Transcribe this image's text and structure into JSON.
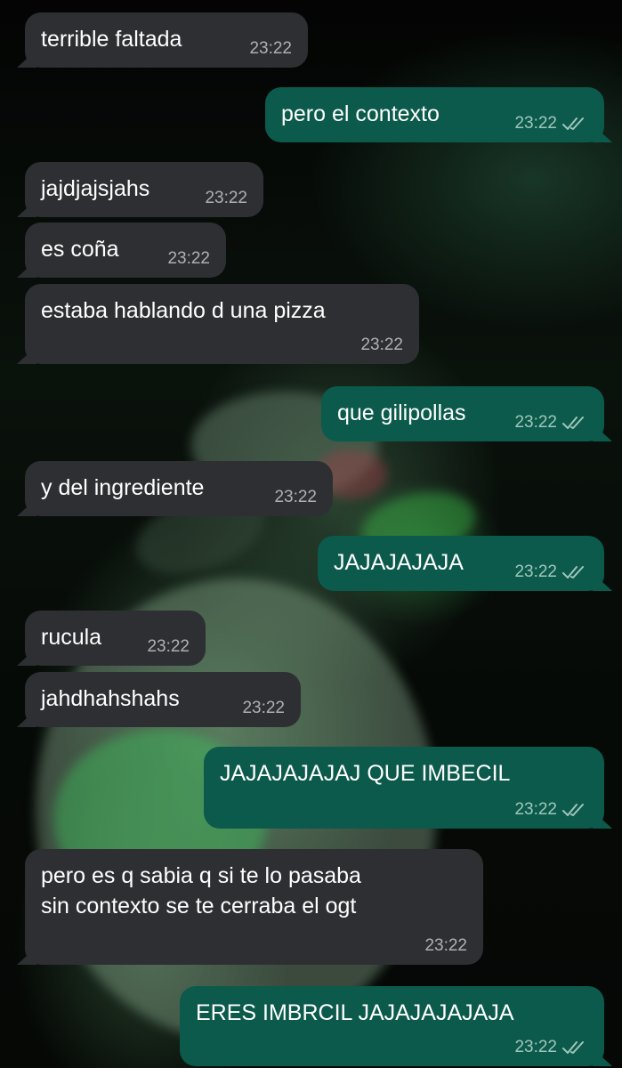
{
  "chat": {
    "messages": [
      {
        "direction": "incoming",
        "text": "terrible faltada",
        "time": "23:22"
      },
      {
        "direction": "outgoing",
        "text": "pero el contexto",
        "time": "23:22",
        "status": "read"
      },
      {
        "direction": "incoming",
        "text": "jajdjajsjahs",
        "time": "23:22"
      },
      {
        "direction": "incoming",
        "text": "es coña",
        "time": "23:22"
      },
      {
        "direction": "incoming",
        "text": "estaba hablando d una pizza",
        "time": "23:22"
      },
      {
        "direction": "outgoing",
        "text": "que gilipollas",
        "time": "23:22",
        "status": "read"
      },
      {
        "direction": "incoming",
        "text": "y del ingrediente",
        "time": "23:22"
      },
      {
        "direction": "outgoing",
        "text": "JAJAJAJAJA",
        "time": "23:22",
        "status": "read"
      },
      {
        "direction": "incoming",
        "text": "rucula",
        "time": "23:22"
      },
      {
        "direction": "incoming",
        "text": "jahdhahshahs",
        "time": "23:22"
      },
      {
        "direction": "outgoing",
        "text": "JAJAJAJAJAJ QUE IMBECIL",
        "time": "23:22",
        "status": "read"
      },
      {
        "direction": "incoming",
        "text": "pero es q sabia q si te lo pasaba\nsin contexto se te cerraba el ogt",
        "time": "23:22"
      },
      {
        "direction": "outgoing",
        "text": "ERES IMBRCIL JAJAJAJAJAJA",
        "time": "23:22",
        "status": "read"
      }
    ]
  },
  "colors": {
    "incoming_bubble": "#2e2f33",
    "outgoing_bubble": "#0b5a4b",
    "text": "#ffffff",
    "timestamp": "#9a9a9a"
  },
  "icons": {
    "read_receipt": "double-check-icon"
  }
}
